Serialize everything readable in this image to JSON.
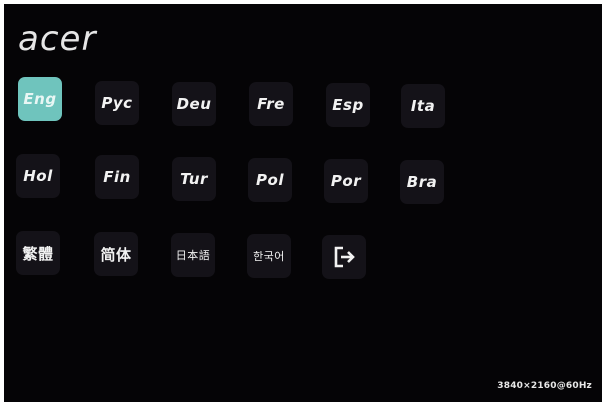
{
  "brand": {
    "logo_text": "acer"
  },
  "languages": {
    "row1": [
      {
        "label": "Eng",
        "selected": true
      },
      {
        "label": "Рус"
      },
      {
        "label": "Deu"
      },
      {
        "label": "Fre"
      },
      {
        "label": "Esp"
      },
      {
        "label": "Ita"
      }
    ],
    "row2": [
      {
        "label": "Hol"
      },
      {
        "label": "Fin"
      },
      {
        "label": "Tur"
      },
      {
        "label": "Pol"
      },
      {
        "label": "Por"
      },
      {
        "label": "Bra"
      }
    ],
    "row3": [
      {
        "label": "繁體"
      },
      {
        "label": "简体"
      },
      {
        "label": "日本語"
      },
      {
        "label": "한국어"
      }
    ]
  },
  "exit": {
    "icon": "exit-icon"
  },
  "status": {
    "resolution": "3840×2160@60Hz"
  },
  "colors": {
    "background": "#050406",
    "tile": "#141218",
    "selected_tile": "#6fc4bd",
    "text": "#f2f2f2"
  }
}
